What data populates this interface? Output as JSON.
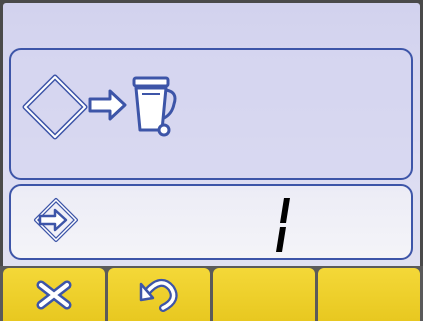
{
  "display": {
    "action_panel": {
      "icons": [
        "enter-diamond-icon",
        "arrow-right-icon",
        "trash-bin-icon"
      ]
    },
    "value_panel": {
      "icon": "enter-diamond-icon",
      "digit_value": "1"
    }
  },
  "softkeys": [
    {
      "name": "cancel",
      "icon": "cancel-x-icon"
    },
    {
      "name": "undo",
      "icon": "undo-arrow-icon"
    },
    {
      "name": "softkey-3",
      "icon": ""
    },
    {
      "name": "softkey-4",
      "icon": ""
    }
  ],
  "colors": {
    "screen_bg": "#d8d8f0",
    "panel_border": "#3d55a8",
    "icon_blue": "#3d55a8",
    "softkey_yellow": "#f0d42c",
    "digit": "#000000"
  }
}
